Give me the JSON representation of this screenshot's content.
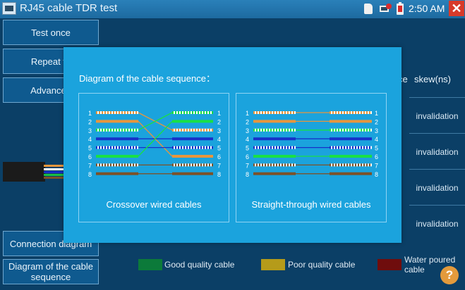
{
  "app": {
    "title": "RJ45 cable TDR test",
    "time": "2:50 AM",
    "close_glyph": "✕"
  },
  "left_buttons": {
    "test_once": "Test once",
    "repeat": "Repeat te",
    "advanced": "Advanced",
    "connection": "Connection diagram",
    "sequence_line1": "Diagram of the cable",
    "sequence_line2": "sequence"
  },
  "table": {
    "header_partial": "ce",
    "header_skew": "skew(ns)",
    "rows": [
      "invalidation",
      "invalidation",
      "invalidation",
      "invalidation"
    ]
  },
  "legend": {
    "good": {
      "label": "Good quality cable",
      "color": "#0c7a3a"
    },
    "poor": {
      "label": "Poor quality cable",
      "color": "#b59b1a"
    },
    "water": {
      "label_line1": "Water poured",
      "label_line2": "cable",
      "color": "#6f0d0d"
    }
  },
  "dialog": {
    "title": "Diagram of the cable sequence：",
    "crossover_label": "Crossover wired cables",
    "straight_label": "Straight-through wired cables",
    "pin_numbers": [
      "1",
      "2",
      "3",
      "4",
      "5",
      "6",
      "7",
      "8"
    ],
    "colors": {
      "orange": "#e8963c",
      "green": "#19e045",
      "blue": "#1730c8",
      "brown": "#7d5228",
      "white": "#ffffff"
    }
  },
  "icons": {
    "help": "?"
  }
}
